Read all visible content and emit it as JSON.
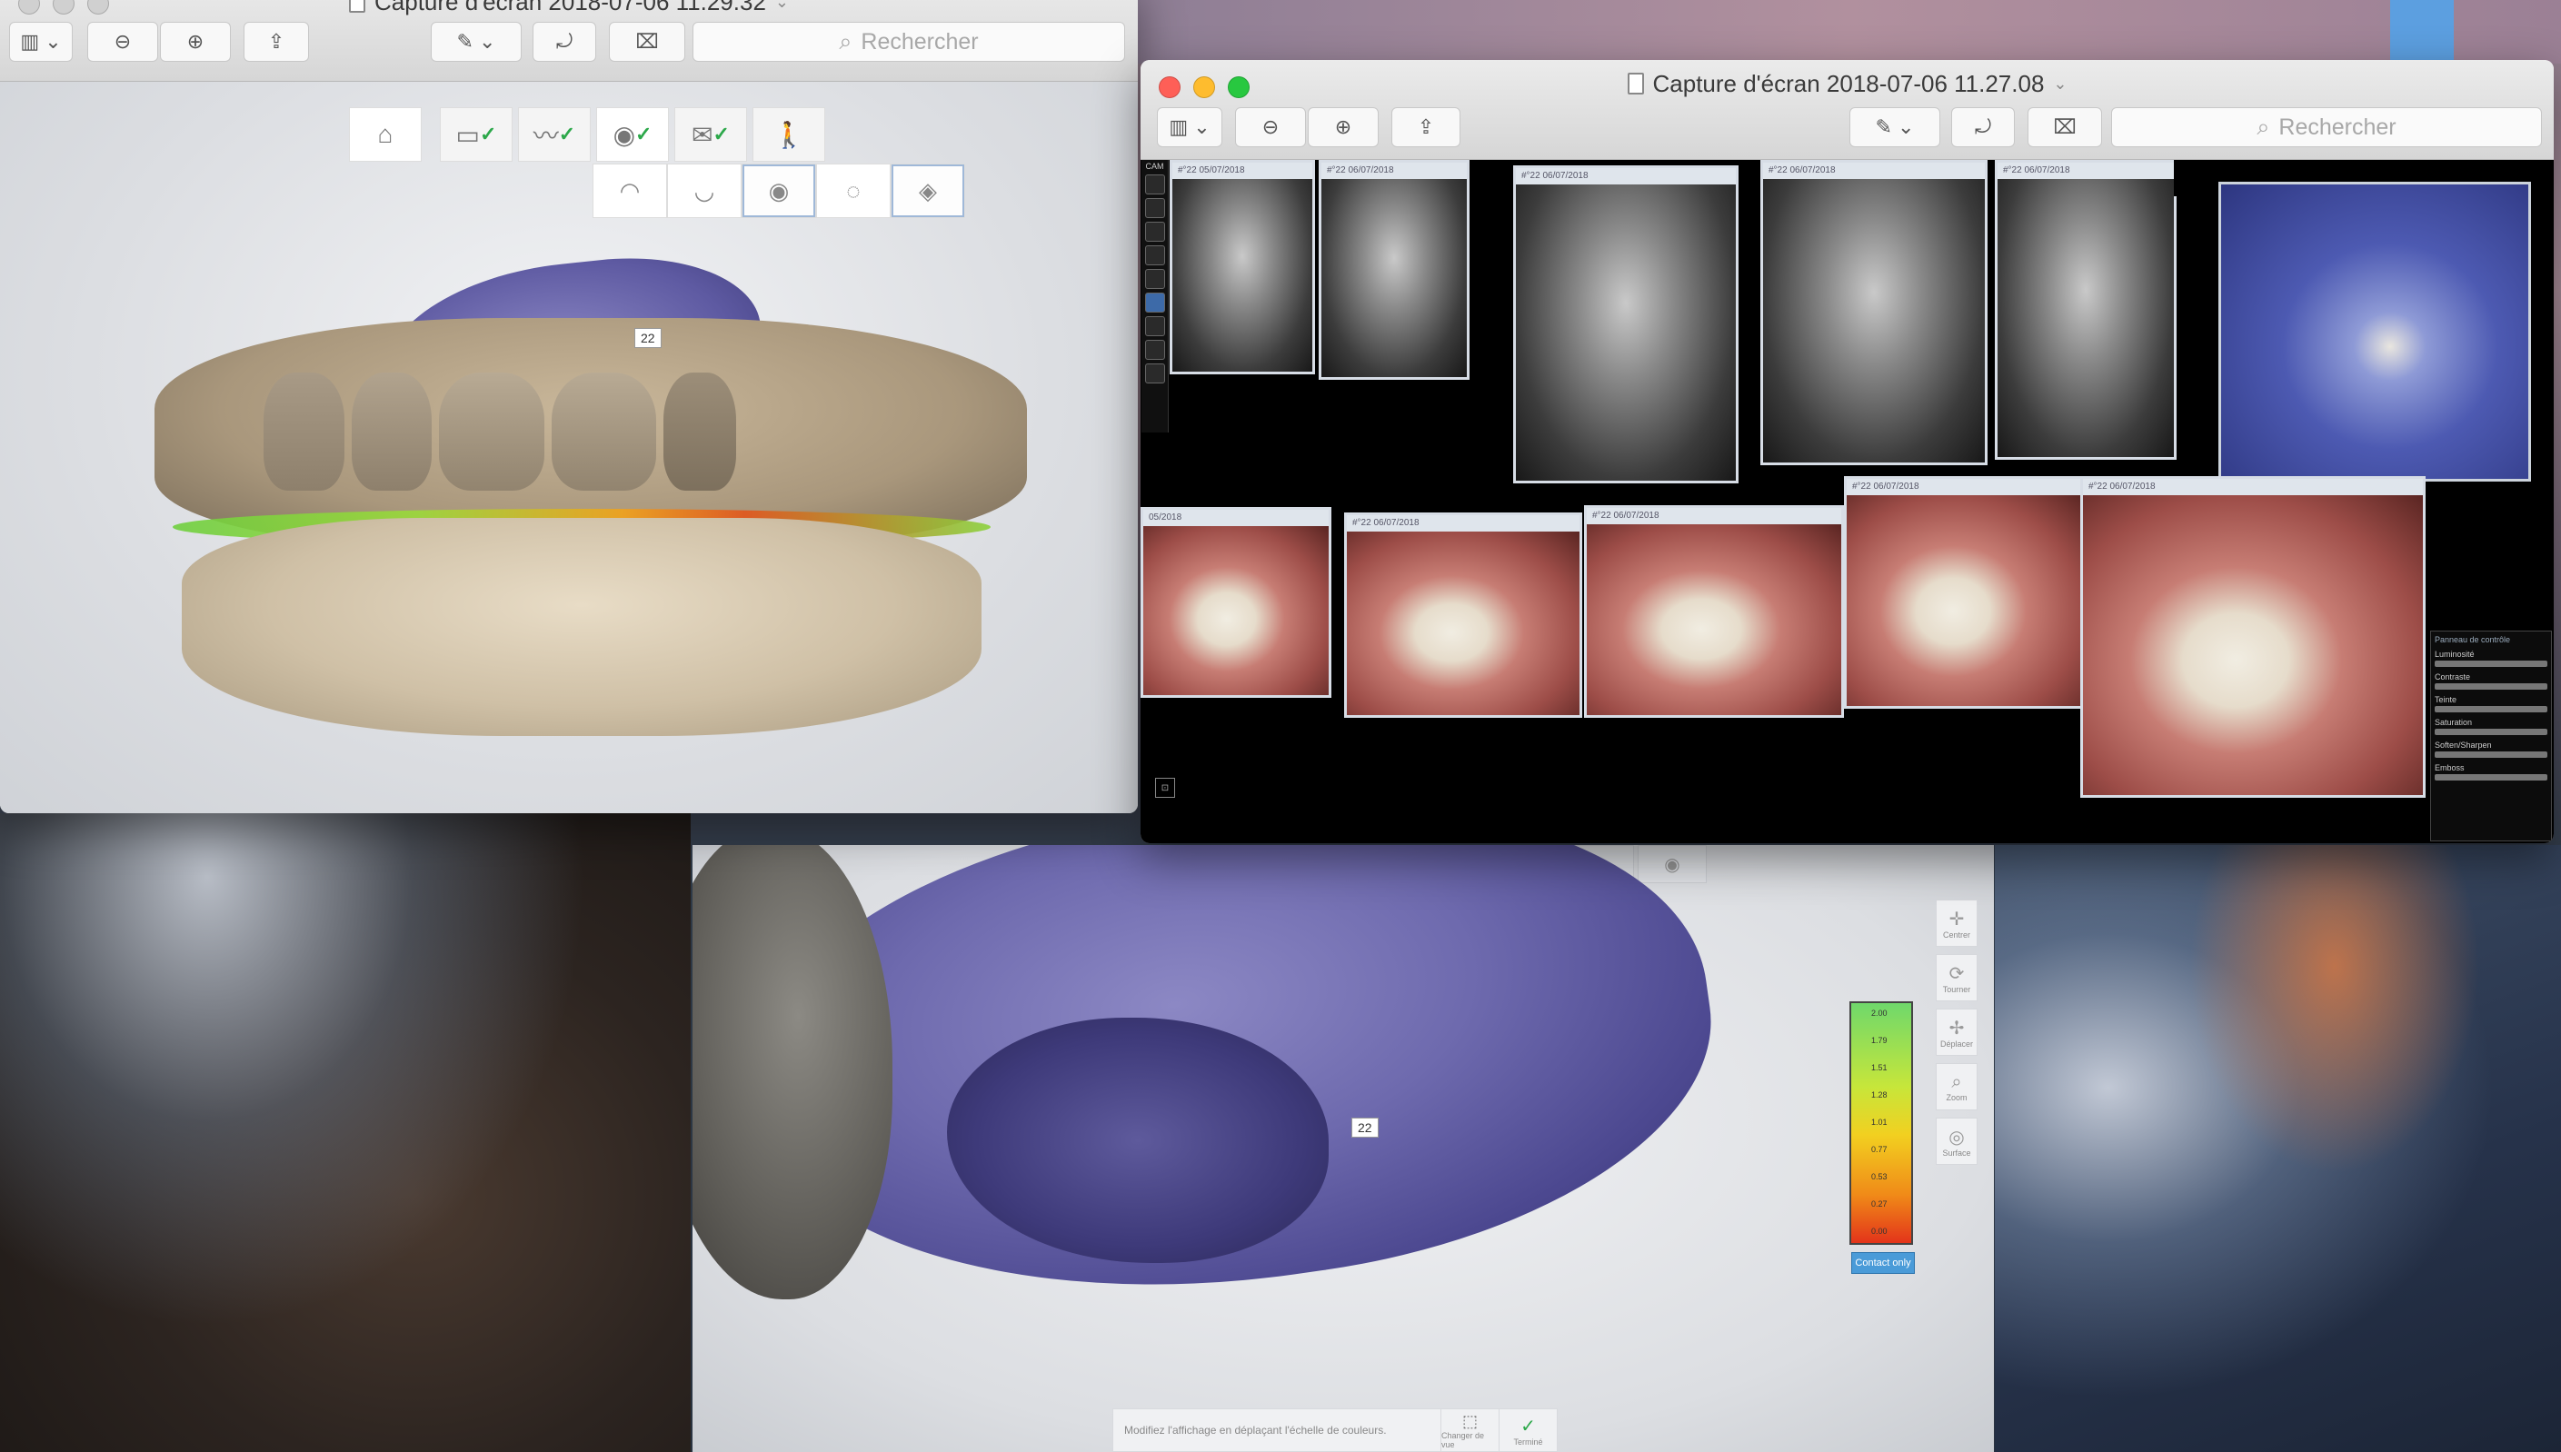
{
  "windows": {
    "preview_3d": {
      "title": "Capture d'écran 2018-07-06 11.29.32",
      "search_placeholder": "Rechercher",
      "tooth_label": "22"
    },
    "preview_imaging": {
      "title": "Capture d'écran 2018-07-06 11.27.08",
      "search_placeholder": "Rechercher",
      "cam_label": "CAM",
      "thumb_headers": [
        "#°22 05/07/2018",
        "#°22 06/07/2018",
        "#°22 06/07/2018",
        "#°22 06/07/2018",
        "#°22 06/07/2018",
        "05/2018",
        "#°22 06/07/2018",
        "#°22 06/07/2018",
        "#°22 06/07/2018",
        "#°22 06/07/2018"
      ],
      "control_panel": {
        "title": "Panneau de contrôle",
        "rows": [
          "Luminosité",
          "Contraste",
          "Teinte",
          "Saturation",
          "Soften/Sharpen",
          "Emboss"
        ]
      }
    }
  },
  "viewer3d": {
    "tooth_label": "22",
    "side_tools": [
      {
        "icon": "center-icon",
        "label": "Centrer"
      },
      {
        "icon": "rotate-icon",
        "label": "Tourner"
      },
      {
        "icon": "move-icon",
        "label": "Déplacer"
      },
      {
        "icon": "zoom-icon",
        "label": "Zoom"
      },
      {
        "icon": "surface-icon",
        "label": "Surface"
      }
    ],
    "scale_ticks": [
      "2.00",
      "1.79",
      "1.51",
      "1.28",
      "1.01",
      "0.77",
      "0.53",
      "0.27",
      "0.00"
    ],
    "contact_only_label": "Contact only",
    "bottom_bar": {
      "hint": "Modifiez l'affichage en déplaçant l'échelle de couleurs.",
      "change_view_label": "Changer de vue",
      "done_label": "Terminé"
    }
  },
  "colors": {
    "accent_blue": "#4a9bd8",
    "scan_purple": "#6e6aae",
    "gingiva_tan": "#c9b79a",
    "ok_green": "#2ca84a"
  }
}
